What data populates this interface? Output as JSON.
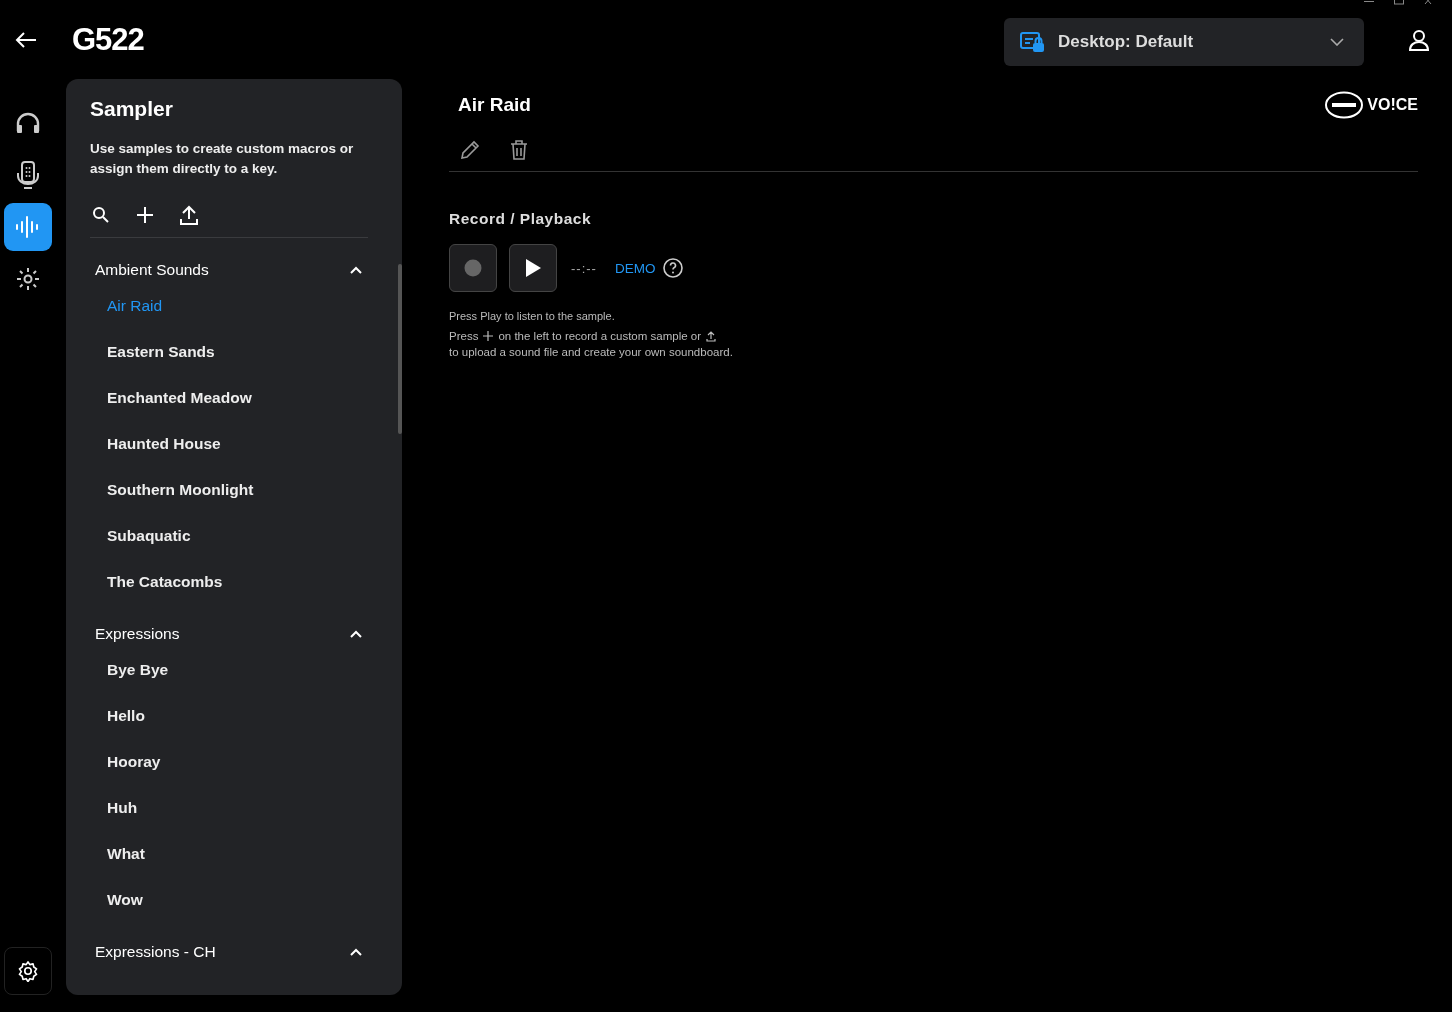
{
  "header": {
    "title": "G522",
    "profile": "Desktop: Default"
  },
  "rail": [
    {
      "kind": "headphones",
      "selected": false
    },
    {
      "kind": "device",
      "selected": false
    },
    {
      "kind": "sampler",
      "selected": true
    },
    {
      "kind": "lighting",
      "selected": false
    }
  ],
  "sampler": {
    "title": "Sampler",
    "description": "Use samples to create custom macros or assign them directly to a key.",
    "groups": [
      {
        "name": "Ambient Sounds",
        "expanded": true,
        "items": [
          {
            "label": "Air Raid",
            "selected": true
          },
          {
            "label": "Eastern Sands",
            "selected": false
          },
          {
            "label": "Enchanted Meadow",
            "selected": false
          },
          {
            "label": "Haunted House",
            "selected": false
          },
          {
            "label": "Southern Moonlight",
            "selected": false
          },
          {
            "label": "Subaquatic",
            "selected": false
          },
          {
            "label": "The Catacombs",
            "selected": false
          }
        ]
      },
      {
        "name": "Expressions",
        "expanded": true,
        "items": [
          {
            "label": "Bye Bye",
            "selected": false
          },
          {
            "label": "Hello",
            "selected": false
          },
          {
            "label": "Hooray",
            "selected": false
          },
          {
            "label": "Huh",
            "selected": false
          },
          {
            "label": "What",
            "selected": false
          },
          {
            "label": "Wow",
            "selected": false
          }
        ]
      },
      {
        "name": "Expressions - CH",
        "expanded": true
      }
    ]
  },
  "detail": {
    "title": "Air Raid",
    "brand": "VO!CE",
    "section": "Record / Playback",
    "time": "--:--",
    "demo": "DEMO",
    "hint": "Press Play to listen to the sample.",
    "help": [
      "Press",
      "on the left to record a custom sample or",
      "to upload a sound file and create your own soundboard."
    ]
  }
}
